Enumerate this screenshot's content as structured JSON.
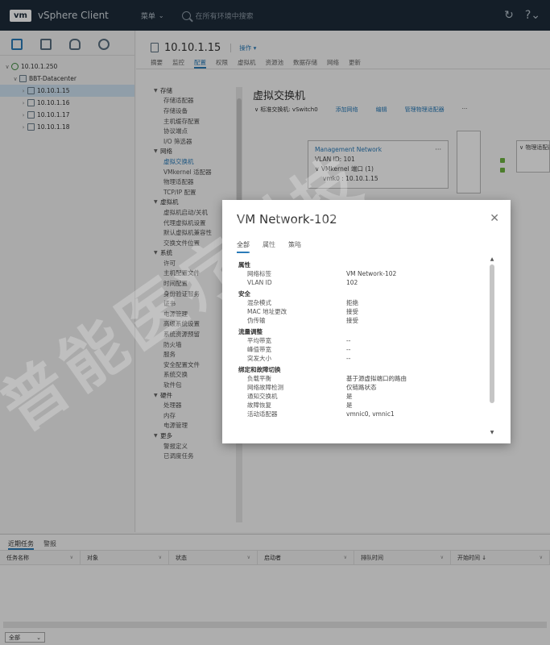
{
  "topbar": {
    "logo": "vm",
    "app_name": "vSphere Client",
    "menu": "菜单",
    "search_placeholder": "在所有环境中搜索"
  },
  "navigator": {
    "tree": [
      {
        "label": "10.10.1.250",
        "level": 0,
        "type": "vcenter",
        "expanded": true
      },
      {
        "label": "BBT-Datacenter",
        "level": 1,
        "type": "datacenter",
        "expanded": true
      },
      {
        "label": "10.10.1.15",
        "level": 2,
        "type": "host",
        "selected": true
      },
      {
        "label": "10.10.1.16",
        "level": 2,
        "type": "host"
      },
      {
        "label": "10.10.1.17",
        "level": 2,
        "type": "host"
      },
      {
        "label": "10.10.1.18",
        "level": 2,
        "type": "host"
      }
    ]
  },
  "host": {
    "title": "10.10.1.15",
    "actions": "操作 ▾",
    "tabs": [
      "摘要",
      "监控",
      "配置",
      "权限",
      "虚拟机",
      "资源池",
      "数据存储",
      "网络",
      "更新"
    ],
    "active_tab": "配置"
  },
  "config_nav": {
    "groups": [
      {
        "label": "存储",
        "items": [
          "存储适配器",
          "存储设备",
          "主机缓存配置",
          "协议端点",
          "I/O 筛选器"
        ]
      },
      {
        "label": "网络",
        "items": [
          "虚拟交换机",
          "VMkernel 适配器",
          "物理适配器",
          "TCP/IP 配置"
        ]
      },
      {
        "label": "虚拟机",
        "items": [
          "虚拟机启动/关机",
          "代理虚拟机设置",
          "默认虚拟机兼容性",
          "交换文件位置"
        ]
      },
      {
        "label": "系统",
        "items": [
          "许可",
          "主机配置文件",
          "时间配置",
          "身份验证服务",
          "证书",
          "电源管理",
          "高级系统设置",
          "系统资源预留",
          "防火墙",
          "服务",
          "安全配置文件",
          "系统交换",
          "软件包"
        ]
      },
      {
        "label": "硬件",
        "items": [
          "处理器",
          "内存",
          "电源管理"
        ]
      },
      {
        "label": "更多",
        "items": [
          "警报定义",
          "已调度任务"
        ]
      }
    ]
  },
  "content": {
    "section_title": "虚拟交换机",
    "vswitch_label": "∨ 标准交换机: vSwitch0",
    "add_network": "添加网络",
    "edit": "编辑",
    "manage_physical": "管理物理适配器",
    "more": "···",
    "portgroup": {
      "name": "Management Network",
      "vlan": "VLAN ID: 101",
      "vmkernel": "∨ VMkernel 端口 (1)",
      "vmk": "vmk0 : 10.10.1.15",
      "dots": "···"
    },
    "physical": "∨ 物理适配器"
  },
  "dialog": {
    "title": "VM Network-102",
    "tabs": [
      "全部",
      "属性",
      "策略"
    ],
    "active_tab": "全部",
    "sections": [
      {
        "title": "属性",
        "rows": [
          [
            "网络标签",
            "VM Network-102"
          ],
          [
            "VLAN ID",
            "102"
          ]
        ]
      },
      {
        "title": "安全",
        "rows": [
          [
            "混杂模式",
            "拒绝"
          ],
          [
            "MAC 地址更改",
            "接受"
          ],
          [
            "伪传输",
            "接受"
          ]
        ]
      },
      {
        "title": "流量调整",
        "rows": [
          [
            "平均带宽",
            "--"
          ],
          [
            "峰值带宽",
            "--"
          ],
          [
            "突发大小",
            "--"
          ]
        ]
      },
      {
        "title": "绑定和故障切换",
        "rows": [
          [
            "负载平衡",
            "基于源虚拟端口的路由"
          ],
          [
            "网络故障检测",
            "仅链路状态"
          ],
          [
            "通知交换机",
            "是"
          ],
          [
            "故障恢复",
            "是"
          ],
          [
            "活动适配器",
            "vmnic0, vmnic1"
          ]
        ]
      }
    ]
  },
  "bottom": {
    "tabs": [
      "近期任务",
      "警报"
    ],
    "active_tab": "近期任务",
    "columns": [
      "任务名称",
      "对象",
      "状态",
      "启动者",
      "排队时间",
      "开始时间 ↓"
    ],
    "filter": "全部"
  },
  "watermark": {
    "text": "普能医疗科技"
  }
}
